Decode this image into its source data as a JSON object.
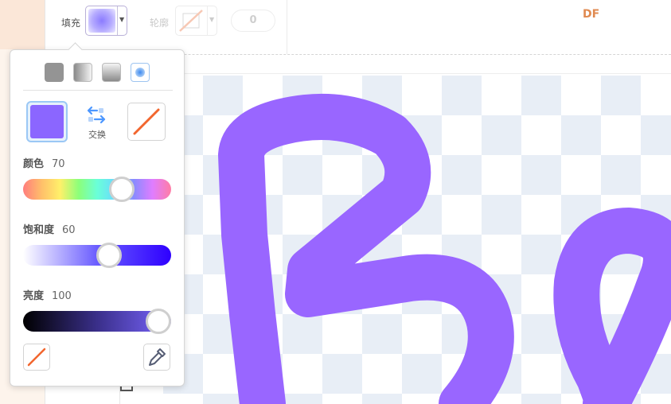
{
  "toolbar": {
    "fill_label": "填充",
    "outline_label": "轮廓",
    "stroke_width": "0",
    "costume_name": "DF"
  },
  "popover": {
    "gradient_types": [
      "solid",
      "horizontal",
      "vertical",
      "radial"
    ],
    "selected_gradient_type": "radial",
    "swap_label": "交换",
    "color_a": "#8b66ff",
    "sliders": [
      {
        "label": "颜色",
        "value": "70",
        "fraction": 0.7
      },
      {
        "label": "饱和度",
        "value": "60",
        "fraction": 0.6
      },
      {
        "label": "亮度",
        "value": "100",
        "fraction": 1.0
      }
    ]
  },
  "drawing": {
    "stroke_color": "#9966ff",
    "text": "Bo"
  },
  "colors": {
    "accent_orange": "#e08a50",
    "swap_blue": "#4c97ff",
    "none_slash": "#f2662e"
  }
}
